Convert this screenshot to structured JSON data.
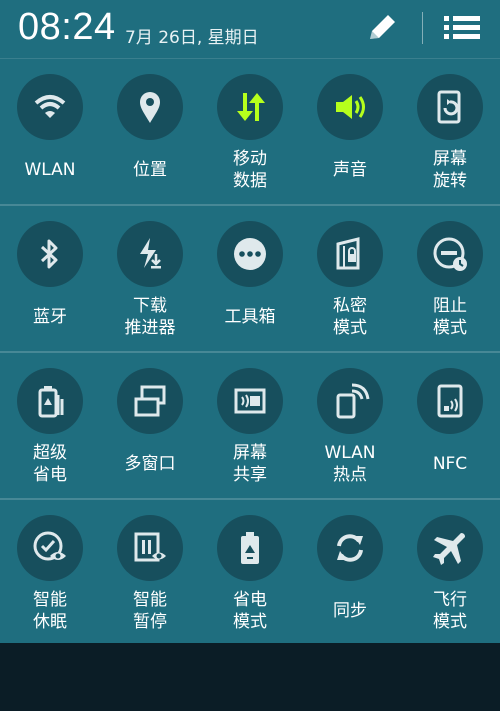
{
  "header": {
    "time": "08:24",
    "date": "7月 26日, 星期日"
  },
  "colors": {
    "panel_bg": "#1f6e7f",
    "circle_bg": "#174f5d",
    "active_icon": "#b6ff1c",
    "inactive_icon": "#dfe9ec"
  },
  "toggles": [
    {
      "label": "WLAN",
      "icon": "wifi-icon",
      "active": false
    },
    {
      "label": "位置",
      "icon": "location-pin-icon",
      "active": false
    },
    {
      "label": "移动\n数据",
      "icon": "mobile-data-icon",
      "active": true
    },
    {
      "label": "声音",
      "icon": "sound-icon",
      "active": true
    },
    {
      "label": "屏幕\n旋转",
      "icon": "screen-rotation-icon",
      "active": false
    },
    {
      "label": "蓝牙",
      "icon": "bluetooth-icon",
      "active": false
    },
    {
      "label": "下载\n推进器",
      "icon": "download-booster-icon",
      "active": false
    },
    {
      "label": "工具箱",
      "icon": "toolbox-icon",
      "active": false
    },
    {
      "label": "私密\n模式",
      "icon": "private-mode-icon",
      "active": false
    },
    {
      "label": "阻止\n模式",
      "icon": "blocking-mode-icon",
      "active": false
    },
    {
      "label": "超级\n省电",
      "icon": "ultra-power-saving-icon",
      "active": false
    },
    {
      "label": "多窗口",
      "icon": "multi-window-icon",
      "active": false
    },
    {
      "label": "屏幕\n共享",
      "icon": "screen-mirroring-icon",
      "active": false
    },
    {
      "label": "WLAN\n热点",
      "icon": "wifi-hotspot-icon",
      "active": false
    },
    {
      "label": "NFC",
      "icon": "nfc-icon",
      "active": false
    },
    {
      "label": "智能\n休眠",
      "icon": "smart-stay-icon",
      "active": false
    },
    {
      "label": "智能\n暂停",
      "icon": "smart-pause-icon",
      "active": false
    },
    {
      "label": "省电\n模式",
      "icon": "power-saving-icon",
      "active": false
    },
    {
      "label": "同步",
      "icon": "sync-icon",
      "active": false
    },
    {
      "label": "飞行\n模式",
      "icon": "airplane-icon",
      "active": false
    }
  ]
}
